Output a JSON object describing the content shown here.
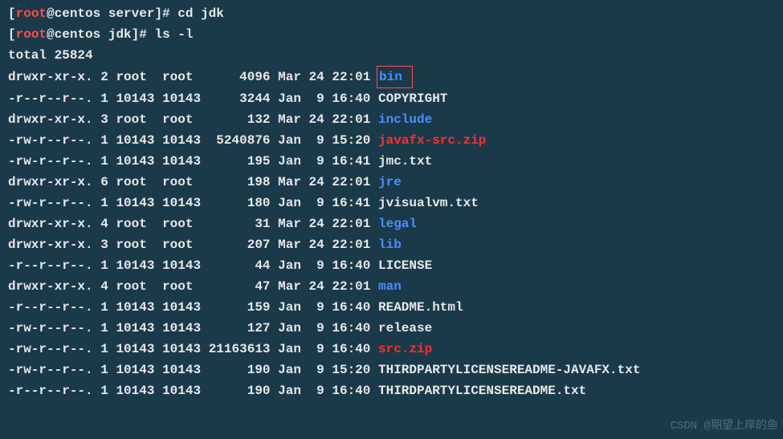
{
  "prompt1": {
    "open": "[",
    "user": "root",
    "at": "@",
    "host": "centos",
    "dir": "server",
    "close": "]# ",
    "cmd": "cd jdk"
  },
  "prompt2": {
    "open": "[",
    "user": "root",
    "at": "@",
    "host": "centos",
    "dir": "jdk",
    "close": "]# ",
    "cmd": "ls -l"
  },
  "total": "total 25824",
  "rows": [
    {
      "perm": "drwxr-xr-x.",
      "n": "2",
      "u": "root ",
      "g": "root ",
      "s": "    4096",
      "m": "Mar",
      "d": "24",
      "t": "22:01",
      "name": "bin",
      "cls": "dir",
      "box": true
    },
    {
      "perm": "-r--r--r--.",
      "n": "1",
      "u": "10143",
      "g": "10143",
      "s": "    3244",
      "m": "Jan",
      "d": " 9",
      "t": "16:40",
      "name": "COPYRIGHT",
      "cls": ""
    },
    {
      "perm": "drwxr-xr-x.",
      "n": "3",
      "u": "root ",
      "g": "root ",
      "s": "     132",
      "m": "Mar",
      "d": "24",
      "t": "22:01",
      "name": "include",
      "cls": "dir"
    },
    {
      "perm": "-rw-r--r--.",
      "n": "1",
      "u": "10143",
      "g": "10143",
      "s": " 5240876",
      "m": "Jan",
      "d": " 9",
      "t": "15:20",
      "name": "javafx-src.zip",
      "cls": "zip"
    },
    {
      "perm": "-rw-r--r--.",
      "n": "1",
      "u": "10143",
      "g": "10143",
      "s": "     195",
      "m": "Jan",
      "d": " 9",
      "t": "16:41",
      "name": "jmc.txt",
      "cls": ""
    },
    {
      "perm": "drwxr-xr-x.",
      "n": "6",
      "u": "root ",
      "g": "root ",
      "s": "     198",
      "m": "Mar",
      "d": "24",
      "t": "22:01",
      "name": "jre",
      "cls": "dir"
    },
    {
      "perm": "-rw-r--r--.",
      "n": "1",
      "u": "10143",
      "g": "10143",
      "s": "     180",
      "m": "Jan",
      "d": " 9",
      "t": "16:41",
      "name": "jvisualvm.txt",
      "cls": ""
    },
    {
      "perm": "drwxr-xr-x.",
      "n": "4",
      "u": "root ",
      "g": "root ",
      "s": "      31",
      "m": "Mar",
      "d": "24",
      "t": "22:01",
      "name": "legal",
      "cls": "dir"
    },
    {
      "perm": "drwxr-xr-x.",
      "n": "3",
      "u": "root ",
      "g": "root ",
      "s": "     207",
      "m": "Mar",
      "d": "24",
      "t": "22:01",
      "name": "lib",
      "cls": "dir"
    },
    {
      "perm": "-r--r--r--.",
      "n": "1",
      "u": "10143",
      "g": "10143",
      "s": "      44",
      "m": "Jan",
      "d": " 9",
      "t": "16:40",
      "name": "LICENSE",
      "cls": ""
    },
    {
      "perm": "drwxr-xr-x.",
      "n": "4",
      "u": "root ",
      "g": "root ",
      "s": "      47",
      "m": "Mar",
      "d": "24",
      "t": "22:01",
      "name": "man",
      "cls": "dir"
    },
    {
      "perm": "-r--r--r--.",
      "n": "1",
      "u": "10143",
      "g": "10143",
      "s": "     159",
      "m": "Jan",
      "d": " 9",
      "t": "16:40",
      "name": "README.html",
      "cls": ""
    },
    {
      "perm": "-rw-r--r--.",
      "n": "1",
      "u": "10143",
      "g": "10143",
      "s": "     127",
      "m": "Jan",
      "d": " 9",
      "t": "16:40",
      "name": "release",
      "cls": ""
    },
    {
      "perm": "-rw-r--r--.",
      "n": "1",
      "u": "10143",
      "g": "10143",
      "s": "21163613",
      "m": "Jan",
      "d": " 9",
      "t": "16:40",
      "name": "src.zip",
      "cls": "zip"
    },
    {
      "perm": "-rw-r--r--.",
      "n": "1",
      "u": "10143",
      "g": "10143",
      "s": "     190",
      "m": "Jan",
      "d": " 9",
      "t": "15:20",
      "name": "THIRDPARTYLICENSEREADME-JAVAFX.txt",
      "cls": ""
    },
    {
      "perm": "-r--r--r--.",
      "n": "1",
      "u": "10143",
      "g": "10143",
      "s": "     190",
      "m": "Jan",
      "d": " 9",
      "t": "16:40",
      "name": "THIRDPARTYLICENSEREADME.txt",
      "cls": ""
    }
  ],
  "watermark": "CSDN @期望上岸的鱼"
}
